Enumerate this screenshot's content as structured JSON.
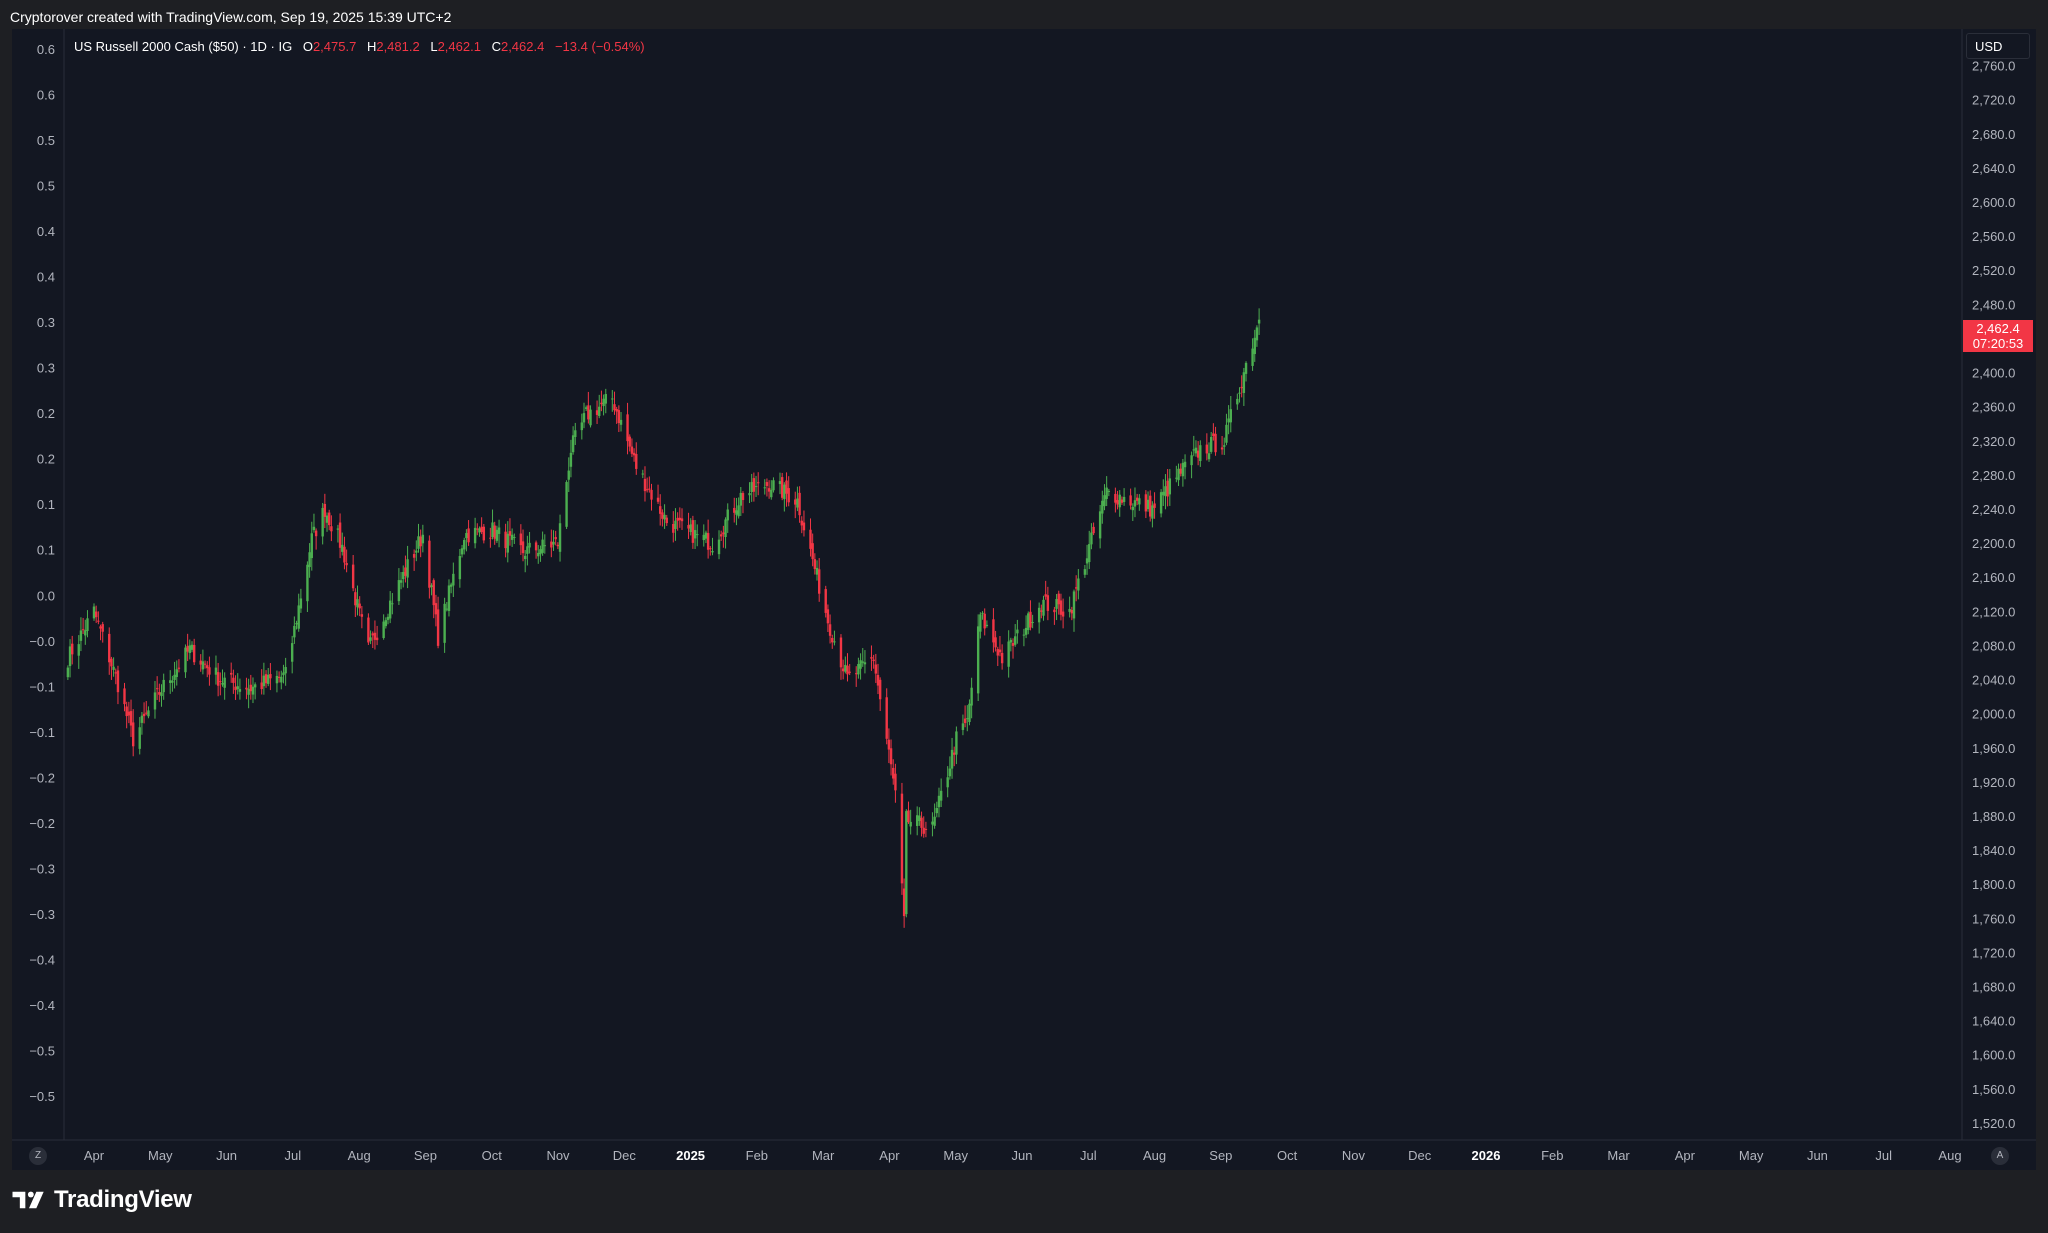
{
  "caption": "Cryptorover created with TradingView.com, Sep 19, 2025 15:39 UTC+2",
  "brand": "TradingView",
  "currency": "USD",
  "legend": {
    "symbol": "US Russell 2000 Cash ($50) · 1D · IG",
    "o_label": "O",
    "o": "2,475.7",
    "h_label": "H",
    "h": "2,481.2",
    "l_label": "L",
    "l": "2,462.1",
    "c_label": "C",
    "c": "2,462.4",
    "change": "−13.4 (−0.54%)"
  },
  "price_tag": {
    "price": "2,462.4",
    "countdown": "07:20:53"
  },
  "axis_buttons": {
    "left": "Z",
    "right": "A"
  },
  "colors": {
    "background": "#131722",
    "up": "#4caf50",
    "down": "#f23645",
    "axis_text": "#b2b5be"
  },
  "chart_data": {
    "type": "candlestick",
    "title": "US Russell 2000 Cash ($50) · 1D · IG",
    "right_axis": {
      "ylim": [
        1500,
        2790
      ],
      "ticks": [
        "2,760.0",
        "2,720.0",
        "2,680.0",
        "2,640.0",
        "2,600.0",
        "2,560.0",
        "2,520.0",
        "2,480.0",
        "2,400.0",
        "2,360.0",
        "2,320.0",
        "2,280.0",
        "2,240.0",
        "2,200.0",
        "2,160.0",
        "2,120.0",
        "2,080.0",
        "2,040.0",
        "2,000.0",
        "1,960.0",
        "1,920.0",
        "1,880.0",
        "1,840.0",
        "1,800.0",
        "1,760.0",
        "1,720.0",
        "1,680.0",
        "1,640.0",
        "1,600.0",
        "1,560.0",
        "1,520.0"
      ]
    },
    "left_axis": {
      "ticks": [
        "0.6",
        "0.6",
        "0.5",
        "0.5",
        "0.4",
        "0.4",
        "0.3",
        "0.3",
        "0.2",
        "0.2",
        "0.1",
        "0.1",
        "0.0",
        "−0.0",
        "−0.1",
        "−0.1",
        "−0.2",
        "−0.2",
        "−0.3",
        "−0.3",
        "−0.4",
        "−0.4",
        "−0.5",
        "−0.5"
      ]
    },
    "x_axis": {
      "labels": [
        {
          "text": "Apr",
          "bold": false
        },
        {
          "text": "May",
          "bold": false
        },
        {
          "text": "Jun",
          "bold": false
        },
        {
          "text": "Jul",
          "bold": false
        },
        {
          "text": "Aug",
          "bold": false
        },
        {
          "text": "Sep",
          "bold": false
        },
        {
          "text": "Oct",
          "bold": false
        },
        {
          "text": "Nov",
          "bold": false
        },
        {
          "text": "Dec",
          "bold": false
        },
        {
          "text": "2025",
          "bold": true
        },
        {
          "text": "Feb",
          "bold": false
        },
        {
          "text": "Mar",
          "bold": false
        },
        {
          "text": "Apr",
          "bold": false
        },
        {
          "text": "May",
          "bold": false
        },
        {
          "text": "Jun",
          "bold": false
        },
        {
          "text": "Jul",
          "bold": false
        },
        {
          "text": "Aug",
          "bold": false
        },
        {
          "text": "Sep",
          "bold": false
        },
        {
          "text": "Oct",
          "bold": false
        },
        {
          "text": "Nov",
          "bold": false
        },
        {
          "text": "Dec",
          "bold": false
        },
        {
          "text": "2026",
          "bold": true
        },
        {
          "text": "Feb",
          "bold": false
        },
        {
          "text": "Mar",
          "bold": false
        },
        {
          "text": "Apr",
          "bold": false
        },
        {
          "text": "May",
          "bold": false
        },
        {
          "text": "Jun",
          "bold": false
        },
        {
          "text": "Jul",
          "bold": false
        },
        {
          "text": "Aug",
          "bold": false
        }
      ]
    },
    "series": [
      {
        "name": "US Russell 2000 Cash ($50)",
        "x": [
          "2024-03-20",
          "2024-04-01",
          "2024-04-12",
          "2024-04-19",
          "2024-05-01",
          "2024-05-15",
          "2024-05-29",
          "2024-06-12",
          "2024-06-28",
          "2024-07-10",
          "2024-07-16",
          "2024-07-24",
          "2024-08-05",
          "2024-08-15",
          "2024-08-30",
          "2024-09-06",
          "2024-09-18",
          "2024-10-01",
          "2024-10-15",
          "2024-10-31",
          "2024-11-06",
          "2024-11-13",
          "2024-11-25",
          "2024-12-06",
          "2024-12-20",
          "2025-01-10",
          "2025-01-23",
          "2025-02-05",
          "2025-02-18",
          "2025-03-04",
          "2025-03-13",
          "2025-03-25",
          "2025-04-04",
          "2025-04-08",
          "2025-04-09",
          "2025-04-21",
          "2025-05-02",
          "2025-05-07",
          "2025-05-13",
          "2025-05-23",
          "2025-06-10",
          "2025-06-23",
          "2025-07-10",
          "2025-07-31",
          "2025-08-12",
          "2025-08-22",
          "2025-09-02",
          "2025-09-12",
          "2025-09-18"
        ],
        "close": [
          2065,
          2120,
          2035,
          1970,
          2025,
          2075,
          2040,
          2030,
          2045,
          2205,
          2240,
          2195,
          2075,
          2130,
          2210,
          2090,
          2210,
          2215,
          2190,
          2200,
          2310,
          2350,
          2370,
          2290,
          2225,
          2200,
          2255,
          2270,
          2250,
          2110,
          2040,
          2065,
          1905,
          1755,
          1875,
          1865,
          1970,
          1990,
          2115,
          2065,
          2130,
          2120,
          2260,
          2240,
          2280,
          2310,
          2320,
          2410,
          2462
        ]
      }
    ]
  }
}
